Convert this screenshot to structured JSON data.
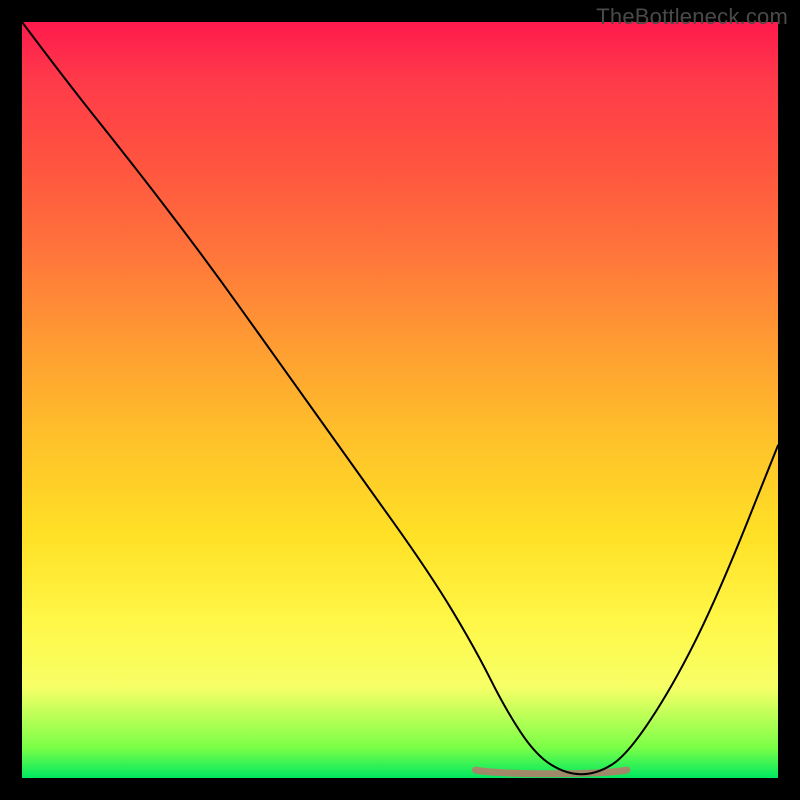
{
  "watermark": "TheBottleneck.com",
  "chart_data": {
    "type": "line",
    "title": "",
    "xlabel": "",
    "ylabel": "",
    "xlim": [
      0,
      100
    ],
    "ylim": [
      0,
      100
    ],
    "series": [
      {
        "name": "bottleneck-curve",
        "x": [
          0,
          6,
          14,
          24,
          34,
          44,
          54,
          60,
          64,
          68,
          72,
          76,
          80,
          86,
          92,
          100
        ],
        "y": [
          100,
          92,
          82,
          69,
          55,
          41,
          27,
          17,
          9,
          3,
          0.5,
          0.5,
          3,
          12,
          24,
          44
        ]
      }
    ],
    "highlight_band": {
      "name": "optimal-range",
      "x_start": 60,
      "x_end": 80,
      "color": "#c86d6d"
    },
    "background_gradient": {
      "stops": [
        {
          "pos": 0.0,
          "color": "#ff1a4d"
        },
        {
          "pos": 0.5,
          "color": "#ffc12a"
        },
        {
          "pos": 0.85,
          "color": "#fff84a"
        },
        {
          "pos": 1.0,
          "color": "#00e860"
        }
      ]
    }
  }
}
